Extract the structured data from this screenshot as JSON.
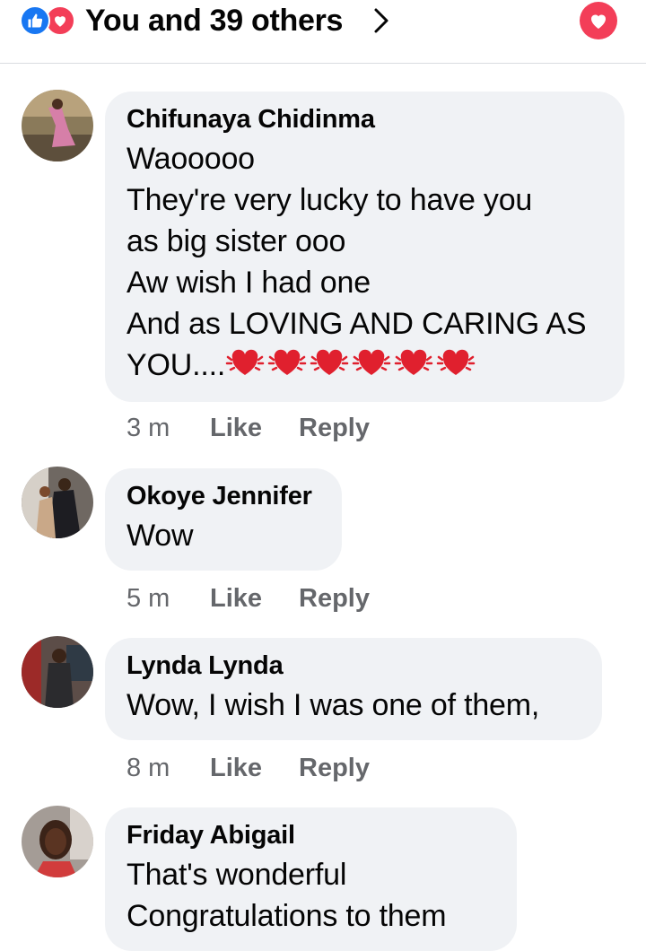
{
  "header": {
    "reactions_text": "You and 39 others",
    "icons": [
      "like-icon",
      "love-icon",
      "chevron-right-icon",
      "love-button-icon"
    ]
  },
  "colors": {
    "like_blue": "#1877f2",
    "love_red": "#f33e58",
    "bubble": "#f0f2f5",
    "meta_gray": "#65676b"
  },
  "comments": [
    {
      "author": "Chifunaya Chidinma",
      "text": "Waooooo\nThey're very lucky to have you\nas big sister ooo\nAw wish I had one\nAnd as LOVING AND CARING AS\nYOU....",
      "emoji": "beating-heart-emoji x6",
      "time": "3 m",
      "like": "Like",
      "reply": "Reply"
    },
    {
      "author": "Okoye Jennifer",
      "text": "Wow",
      "time": "5 m",
      "like": "Like",
      "reply": "Reply"
    },
    {
      "author": "Lynda Lynda",
      "text": "Wow, I wish I was one of them,",
      "time": "8 m",
      "like": "Like",
      "reply": "Reply"
    },
    {
      "author": "Friday Abigail",
      "text": "That's wonderful\nCongratulations to them"
    }
  ]
}
